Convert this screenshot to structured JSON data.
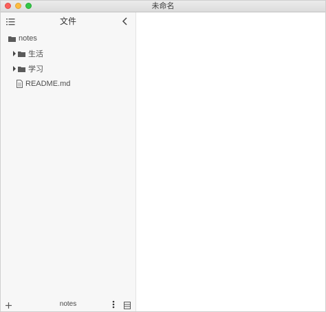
{
  "window": {
    "title": "未命名"
  },
  "sidebar": {
    "title": "文件",
    "outline_icon": "list-icon",
    "collapse_icon": "chevron-left-icon",
    "tree": [
      {
        "label": "notes",
        "type": "folder",
        "expanded": true
      },
      {
        "label": "生活",
        "type": "folder",
        "expanded": false
      },
      {
        "label": "学习",
        "type": "folder",
        "expanded": false
      },
      {
        "label": "README.md",
        "type": "file"
      }
    ],
    "footer": {
      "label": "notes",
      "add_icon": "plus-icon",
      "more_icon": "vertical-ellipsis-icon",
      "view_icon": "list-view-icon"
    }
  },
  "colors": {
    "close": "#fc605c",
    "minimize": "#fdbc40",
    "maximize": "#34c749",
    "sidebar_bg": "#f7f7f7",
    "text": "#4d4d4d"
  }
}
